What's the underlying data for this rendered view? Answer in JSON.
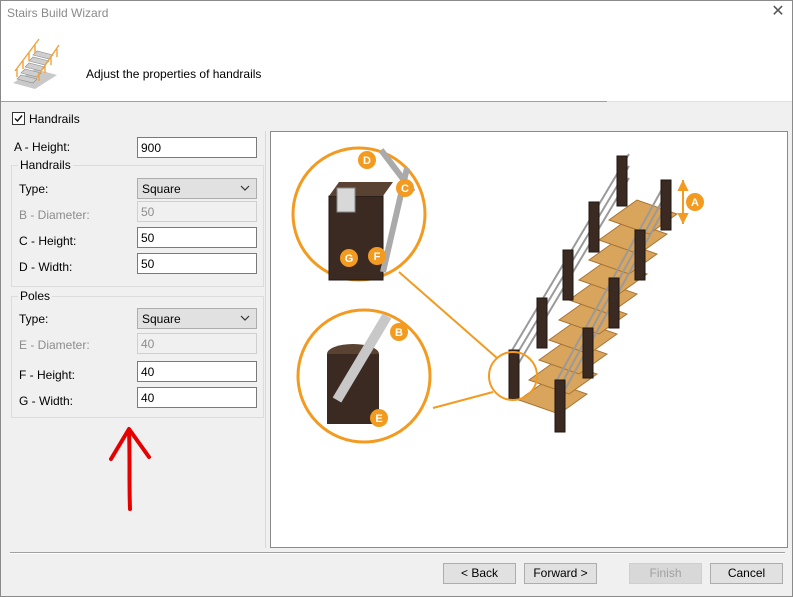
{
  "window": {
    "title": "Stairs Build Wizard",
    "header_text": "Adjust the properties of handrails"
  },
  "handrails_checkbox": {
    "label": "Handrails",
    "checked": true
  },
  "fields": {
    "a_height": {
      "label": "A - Height:",
      "value": "900"
    }
  },
  "handrails_group": {
    "title": "Handrails",
    "type": {
      "label": "Type:",
      "value": "Square"
    },
    "b_diameter": {
      "label": "B - Diameter:",
      "value": "50"
    },
    "c_height": {
      "label": "C - Height:",
      "value": "50"
    },
    "d_width": {
      "label": "D - Width:",
      "value": "50"
    }
  },
  "poles_group": {
    "title": "Poles",
    "type": {
      "label": "Type:",
      "value": "Square"
    },
    "e_diameter": {
      "label": "E - Diameter:",
      "value": "40"
    },
    "f_height": {
      "label": "F - Height:",
      "value": "40"
    },
    "g_width": {
      "label": "G - Width:",
      "value": "40"
    }
  },
  "diagram": {
    "markers": [
      "A",
      "B",
      "C",
      "D",
      "E",
      "F",
      "G"
    ],
    "accent": "#f39a21",
    "post_color": "#3a2a22",
    "tread_color": "#d9a45c"
  },
  "buttons": {
    "back": "< Back",
    "forward": "Forward >",
    "finish": "Finish",
    "cancel": "Cancel"
  },
  "annotation": {
    "arrow_color": "#e60000"
  }
}
